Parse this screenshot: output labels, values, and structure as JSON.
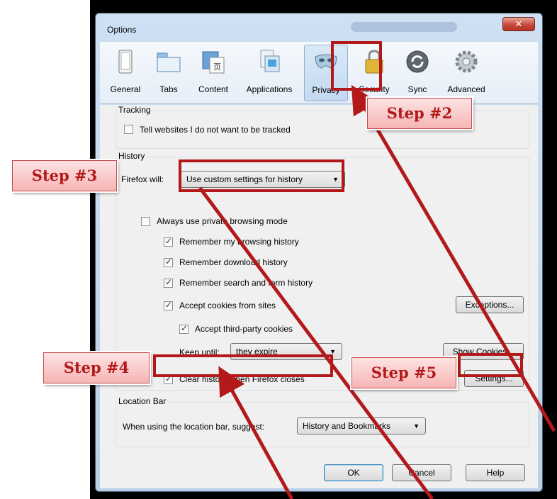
{
  "window": {
    "title": "Options",
    "close_glyph": "✕"
  },
  "tabs": [
    {
      "label": "General",
      "icon": "general-icon"
    },
    {
      "label": "Tabs",
      "icon": "tabs-icon"
    },
    {
      "label": "Content",
      "icon": "content-icon"
    },
    {
      "label": "Applications",
      "icon": "applications-icon"
    },
    {
      "label": "Privacy",
      "icon": "privacy-mask-icon",
      "selected": true
    },
    {
      "label": "Security",
      "icon": "padlock-icon"
    },
    {
      "label": "Sync",
      "icon": "sync-icon"
    },
    {
      "label": "Advanced",
      "icon": "gear-icon"
    }
  ],
  "tracking": {
    "legend": "Tracking",
    "do_not_track": {
      "label": "Tell websites I do not want to be tracked",
      "checked": false
    }
  },
  "history": {
    "legend": "History",
    "firefox_will_label": "Firefox will:",
    "firefox_will_value": "Use custom settings for history",
    "private_mode": {
      "label": "Always use private browsing mode",
      "checked": false
    },
    "remember_browsing": {
      "label": "Remember my browsing history",
      "checked": true
    },
    "remember_download": {
      "label": "Remember download history",
      "checked": true
    },
    "remember_search": {
      "label": "Remember search and form history",
      "checked": true
    },
    "accept_cookies": {
      "label": "Accept cookies from sites",
      "checked": true
    },
    "exceptions_button": "Exceptions...",
    "third_party": {
      "label": "Accept third-party cookies",
      "checked": true
    },
    "keep_until_label": "Keep until:",
    "keep_until_value": "they expire",
    "show_cookies_button": "Show Cookies...",
    "clear_history": {
      "label": "Clear history when Firefox closes",
      "checked": true
    },
    "settings_button": "Settings..."
  },
  "location_bar": {
    "legend": "Location Bar",
    "suggest_label": "When using the location bar, suggest:",
    "suggest_value": "History and Bookmarks"
  },
  "buttons": {
    "ok": "OK",
    "cancel": "Cancel",
    "help": "Help"
  },
  "annotations": {
    "step2": "Step #2",
    "step3": "Step #3",
    "step4": "Step #4",
    "step5": "Step #5",
    "color": "#b3191b"
  }
}
